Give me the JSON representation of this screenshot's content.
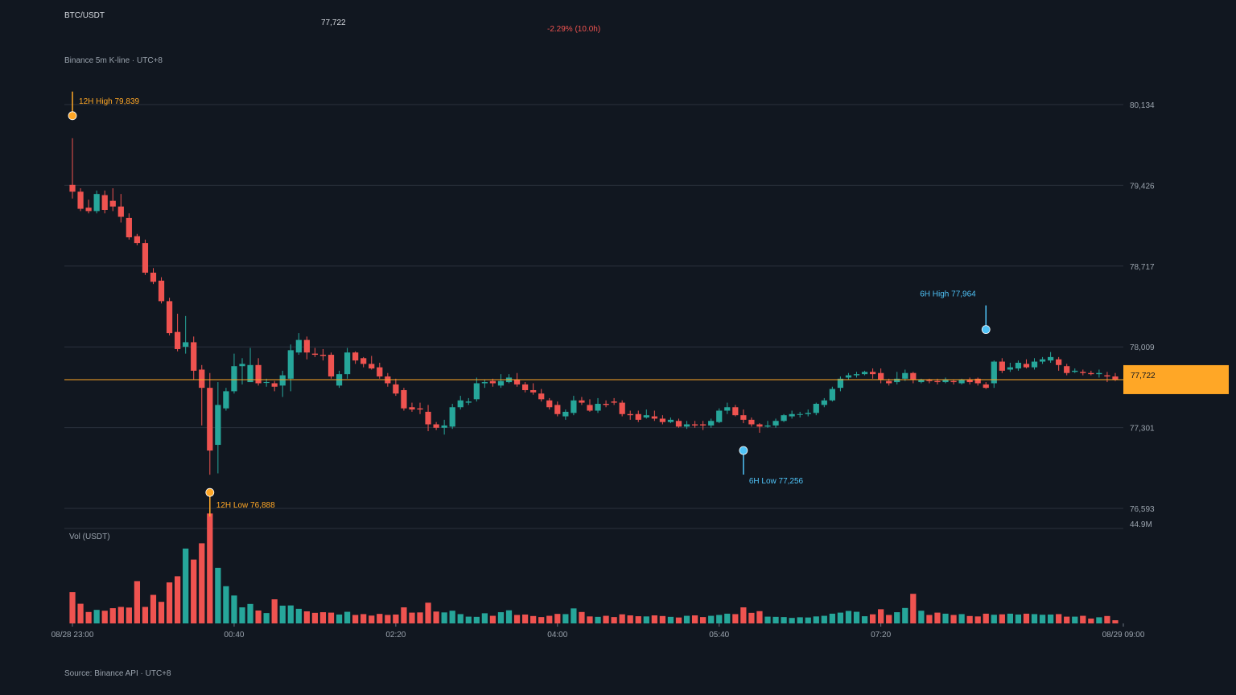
{
  "header": {
    "pair": "BTC/USDT",
    "price": "77,722",
    "change": "-2.29% (10.0h)",
    "subtitle": "Binance 5m K-line · UTC+8",
    "source": "Source: Binance API · UTC+8"
  },
  "colors": {
    "up": "#26a69a",
    "down": "#ef5350",
    "accent": "#ffa726",
    "marker_blue": "#4fc3f7",
    "background": "#111720",
    "grid": "#2a313c"
  },
  "chart_data": {
    "type": "candlestick",
    "interval_minutes": 5,
    "x_tick_labels": [
      "08/28 23:00",
      "00:40",
      "02:20",
      "04:00",
      "05:40",
      "07:20",
      "08/29 09:00"
    ],
    "y_tick_labels": [
      "80,134",
      "79,426",
      "78,717",
      "78,009",
      "77,301",
      "76,593"
    ],
    "ylim": [
      76593,
      80134
    ],
    "volume_label": "Vol (USDT)",
    "volume_max_label": "44.9M",
    "volume_max": 44.9,
    "last_price": 77722,
    "last_price_label": "77,722",
    "annotations": [
      {
        "label": "12H High 79,839",
        "value": 79839,
        "index": 0,
        "kind": "high12"
      },
      {
        "label": "12H Low 76,888",
        "value": 76888,
        "index": 17,
        "kind": "low12"
      },
      {
        "label": "6H High 77,964",
        "value": 77964,
        "index": 113,
        "kind": "high6"
      },
      {
        "label": "6H Low 77,256",
        "value": 77256,
        "index": 83,
        "kind": "low6"
      }
    ],
    "candles": [
      [
        79430,
        79370,
        79839,
        79310,
        14.8
      ],
      [
        79370,
        79220,
        79400,
        79200,
        9.3
      ],
      [
        79230,
        79200,
        79300,
        79180,
        5.4
      ],
      [
        79200,
        79350,
        79380,
        79180,
        6.4
      ],
      [
        79340,
        79210,
        79380,
        79180,
        6.0
      ],
      [
        79290,
        79240,
        79400,
        79200,
        7.2
      ],
      [
        79240,
        79150,
        79350,
        79100,
        7.8
      ],
      [
        79140,
        78970,
        79180,
        78950,
        7.5
      ],
      [
        78980,
        78920,
        79000,
        78900,
        20.0
      ],
      [
        78920,
        78660,
        78950,
        78640,
        7.8
      ],
      [
        78660,
        78580,
        78700,
        78560,
        13.5
      ],
      [
        78590,
        78410,
        78620,
        78390,
        10.2
      ],
      [
        78410,
        78130,
        78440,
        78110,
        19.4
      ],
      [
        78140,
        77990,
        78300,
        77970,
        22.3
      ],
      [
        78010,
        78050,
        78280,
        77950,
        35.4
      ],
      [
        78050,
        77800,
        78100,
        77720,
        30.2
      ],
      [
        77810,
        77650,
        77850,
        77320,
        37.9
      ],
      [
        77650,
        77100,
        77780,
        76888,
        52.0
      ],
      [
        77150,
        77500,
        77700,
        76900,
        26.3
      ],
      [
        77470,
        77620,
        77650,
        77450,
        17.6
      ],
      [
        77620,
        77840,
        77950,
        77600,
        13.2
      ],
      [
        77840,
        77860,
        77910,
        77680,
        7.6
      ],
      [
        77700,
        77850,
        78000,
        77710,
        9.2
      ],
      [
        77850,
        77690,
        77910,
        77670,
        6.1
      ],
      [
        77700,
        77700,
        77730,
        77660,
        4.9
      ],
      [
        77690,
        77660,
        77710,
        77620,
        11.4
      ],
      [
        77670,
        77760,
        77800,
        77570,
        8.4
      ],
      [
        77730,
        77980,
        78030,
        77620,
        8.5
      ],
      [
        77960,
        78070,
        78130,
        77940,
        6.9
      ],
      [
        78070,
        77960,
        78100,
        77900,
        5.7
      ],
      [
        77950,
        77940,
        78000,
        77920,
        5.0
      ],
      [
        77940,
        77930,
        77990,
        77890,
        5.3
      ],
      [
        77940,
        77750,
        77960,
        77730,
        5.1
      ],
      [
        77670,
        77770,
        77800,
        77650,
        4.2
      ],
      [
        77770,
        77960,
        78000,
        77730,
        5.5
      ],
      [
        77960,
        77890,
        77970,
        77860,
        4.0
      ],
      [
        77910,
        77860,
        77920,
        77830,
        4.4
      ],
      [
        77860,
        77820,
        77930,
        77810,
        3.7
      ],
      [
        77830,
        77750,
        77870,
        77730,
        4.5
      ],
      [
        77750,
        77690,
        77780,
        77660,
        4.0
      ],
      [
        77680,
        77600,
        77730,
        77580,
        4.2
      ],
      [
        77630,
        77470,
        77650,
        77450,
        7.6
      ],
      [
        77480,
        77460,
        77520,
        77440,
        5.1
      ],
      [
        77470,
        77460,
        77520,
        77420,
        5.2
      ],
      [
        77440,
        77330,
        77500,
        77270,
        9.8
      ],
      [
        77330,
        77300,
        77350,
        77280,
        5.6
      ],
      [
        77300,
        77320,
        77370,
        77240,
        5.2
      ],
      [
        77310,
        77480,
        77510,
        77290,
        6.0
      ],
      [
        77480,
        77540,
        77580,
        77460,
        4.4
      ],
      [
        77520,
        77530,
        77560,
        77500,
        3.2
      ],
      [
        77550,
        77690,
        77740,
        77530,
        3.1
      ],
      [
        77690,
        77700,
        77720,
        77650,
        4.8
      ],
      [
        77710,
        77690,
        77730,
        77660,
        3.6
      ],
      [
        77670,
        77710,
        77770,
        77650,
        5.3
      ],
      [
        77700,
        77740,
        77770,
        77690,
        6.2
      ],
      [
        77720,
        77680,
        77780,
        77660,
        4.0
      ],
      [
        77680,
        77630,
        77700,
        77610,
        4.2
      ],
      [
        77630,
        77610,
        77690,
        77590,
        3.5
      ],
      [
        77600,
        77550,
        77640,
        77530,
        3.0
      ],
      [
        77540,
        77480,
        77560,
        77460,
        3.6
      ],
      [
        77500,
        77420,
        77530,
        77400,
        4.5
      ],
      [
        77400,
        77440,
        77460,
        77370,
        4.4
      ],
      [
        77430,
        77540,
        77580,
        77410,
        7.1
      ],
      [
        77540,
        77520,
        77570,
        77500,
        5.4
      ],
      [
        77500,
        77450,
        77550,
        77440,
        3.3
      ],
      [
        77450,
        77510,
        77560,
        77430,
        3.1
      ],
      [
        77510,
        77500,
        77540,
        77480,
        3.6
      ],
      [
        77530,
        77520,
        77560,
        77500,
        3.0
      ],
      [
        77520,
        77420,
        77540,
        77400,
        4.3
      ],
      [
        77420,
        77410,
        77450,
        77370,
        3.8
      ],
      [
        77420,
        77370,
        77450,
        77350,
        3.4
      ],
      [
        77390,
        77410,
        77460,
        77380,
        3.3
      ],
      [
        77400,
        77380,
        77450,
        77360,
        3.8
      ],
      [
        77380,
        77350,
        77410,
        77330,
        3.5
      ],
      [
        77350,
        77370,
        77390,
        77340,
        3.1
      ],
      [
        77360,
        77310,
        77380,
        77300,
        2.8
      ],
      [
        77310,
        77330,
        77360,
        77290,
        3.6
      ],
      [
        77330,
        77320,
        77360,
        77300,
        3.8
      ],
      [
        77330,
        77320,
        77360,
        77280,
        3.0
      ],
      [
        77320,
        77360,
        77380,
        77300,
        3.6
      ],
      [
        77350,
        77450,
        77470,
        77340,
        4.0
      ],
      [
        77450,
        77480,
        77520,
        77420,
        4.6
      ],
      [
        77480,
        77410,
        77500,
        77400,
        4.4
      ],
      [
        77410,
        77370,
        77460,
        77340,
        7.6
      ],
      [
        77370,
        77330,
        77390,
        77310,
        5.0
      ],
      [
        77330,
        77310,
        77340,
        77256,
        5.8
      ],
      [
        77310,
        77320,
        77360,
        77300,
        3.2
      ],
      [
        77320,
        77360,
        77380,
        77300,
        3.1
      ],
      [
        77360,
        77410,
        77420,
        77350,
        3.0
      ],
      [
        77400,
        77420,
        77450,
        77380,
        2.6
      ],
      [
        77420,
        77420,
        77440,
        77390,
        2.9
      ],
      [
        77420,
        77430,
        77460,
        77400,
        2.8
      ],
      [
        77430,
        77510,
        77520,
        77410,
        3.3
      ],
      [
        77500,
        77540,
        77560,
        77480,
        3.6
      ],
      [
        77540,
        77640,
        77660,
        77530,
        4.6
      ],
      [
        77650,
        77730,
        77750,
        77620,
        5.1
      ],
      [
        77740,
        77760,
        77780,
        77720,
        5.9
      ],
      [
        77760,
        77770,
        77790,
        77740,
        5.5
      ],
      [
        77770,
        77790,
        77800,
        77760,
        3.4
      ],
      [
        77790,
        77770,
        77820,
        77730,
        4.3
      ],
      [
        77780,
        77720,
        77820,
        77690,
        6.7
      ],
      [
        77710,
        77690,
        77730,
        77670,
        4.0
      ],
      [
        77700,
        77730,
        77790,
        77680,
        5.3
      ],
      [
        77730,
        77780,
        77810,
        77710,
        7.3
      ],
      [
        77780,
        77720,
        77790,
        77690,
        14.0
      ],
      [
        77700,
        77720,
        77730,
        77690,
        6.0
      ],
      [
        77720,
        77710,
        77730,
        77690,
        4.0
      ],
      [
        77710,
        77700,
        77730,
        77680,
        5.1
      ],
      [
        77700,
        77720,
        77740,
        77690,
        4.6
      ],
      [
        77710,
        77700,
        77720,
        77680,
        4.0
      ],
      [
        77690,
        77720,
        77730,
        77680,
        4.4
      ],
      [
        77720,
        77700,
        77740,
        77680,
        3.5
      ],
      [
        77730,
        77690,
        77740,
        77670,
        3.3
      ],
      [
        77680,
        77650,
        77700,
        77640,
        4.6
      ],
      [
        77690,
        77880,
        77890,
        77650,
        4.1
      ],
      [
        77880,
        77800,
        77910,
        77780,
        4.3
      ],
      [
        77810,
        77830,
        77870,
        77790,
        4.6
      ],
      [
        77820,
        77870,
        77890,
        77800,
        4.2
      ],
      [
        77860,
        77830,
        77900,
        77820,
        4.6
      ],
      [
        77830,
        77880,
        77910,
        77810,
        4.4
      ],
      [
        77880,
        77900,
        77920,
        77860,
        4.1
      ],
      [
        77890,
        77920,
        77964,
        77870,
        4.2
      ],
      [
        77900,
        77850,
        77920,
        77800,
        4.4
      ],
      [
        77840,
        77780,
        77860,
        77760,
        3.2
      ],
      [
        77790,
        77800,
        77820,
        77780,
        3.2
      ],
      [
        77790,
        77780,
        77810,
        77760,
        3.6
      ],
      [
        77780,
        77770,
        77800,
        77760,
        2.3
      ],
      [
        77770,
        77780,
        77810,
        77740,
        2.9
      ],
      [
        77760,
        77750,
        77790,
        77700,
        3.5
      ],
      [
        77750,
        77722,
        77780,
        77710,
        1.5
      ]
    ]
  }
}
